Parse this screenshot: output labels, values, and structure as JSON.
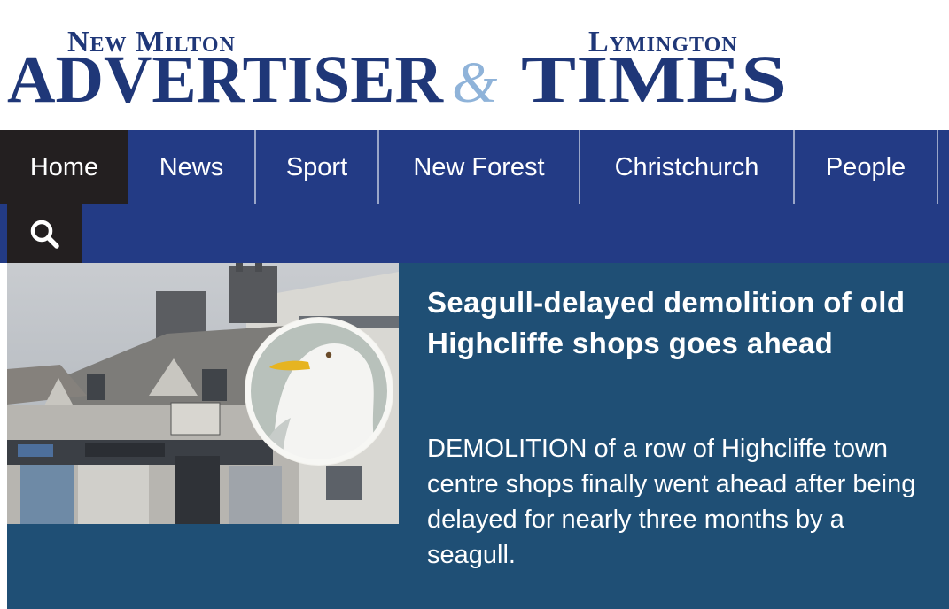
{
  "masthead": {
    "left_small": "New Milton",
    "left_big": "Advertiser",
    "ampersand": "&",
    "right_small": "Lymington",
    "right_big": "Times"
  },
  "nav": {
    "items": [
      {
        "label": "Home",
        "active": true
      },
      {
        "label": "News"
      },
      {
        "label": "Sport"
      },
      {
        "label": "New Forest"
      },
      {
        "label": "Christchurch"
      },
      {
        "label": "People"
      }
    ],
    "search_icon": "search-icon"
  },
  "feature": {
    "headline": "Seagull-delayed demolition of old Highcliffe shops goes ahead",
    "summary": "DEMOLITION of a row of Highcliffe town centre shops finally went ahead after being delayed for nearly three months by a seagull.",
    "image": "shop-row-with-seagull-inset"
  },
  "colors": {
    "brand_navy": "#233b85",
    "logo_navy": "#1f3778",
    "ampersand_blue": "#8fb3d9",
    "active_tab": "#231f20",
    "feature_bg": "#1f4f75"
  }
}
